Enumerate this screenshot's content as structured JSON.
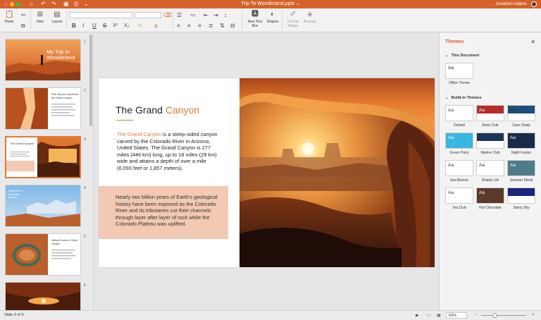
{
  "app": {
    "doc_title": "Trip To Wonderland.pptx",
    "user_name": "Jonathan Adams",
    "accent": "#d4622a"
  },
  "ribbon": {
    "paste": "Paste",
    "new": "New",
    "layout": "Layout",
    "new_text_box": "New Text Box",
    "shapes": "Shapes",
    "format_shape": "Format Shape",
    "arrange": "Arrange",
    "bold": "B",
    "italic": "I",
    "underline": "U",
    "strike": "S",
    "superscript": "X²",
    "subscript": "X₂"
  },
  "slides": {
    "numbers": [
      "1",
      "2",
      "3",
      "4",
      "5",
      "6"
    ],
    "t1_title": "My Trip to Wonderland",
    "t2_title": "Plan will you experience the Grand Canyon",
    "t3_title": "The Grand Canyon",
    "t4_title": "South Rim in the Grand Canyon",
    "t5_title": "Hiking Routes in Grand Canyon"
  },
  "slide": {
    "title_main": "The Grand ",
    "title_accent": "Canyon",
    "body_accent": "The Grand Canyon",
    "body_rest": " is a steep-sided canyon carved by the Colorado River in Arizona, United States. The Grand Canyon is 277 miles (446 km) long, up to 18 miles (29 km) wide and attains a depth of over a mile (6,093 feet or 1,857 meters).",
    "box_text": "Nearly two billion years of Earth's geological history have been exposed as the Colorado River and its tributaries cut their channels through layer after layer of rock while the Colorado Plateau was uplifted."
  },
  "themes": {
    "title": "Themes",
    "this_document": "This Document",
    "built_in": "Build-in Themes",
    "office_theme": "Office Theme",
    "aa": "Aa",
    "items": [
      {
        "name": "Default",
        "bg": "#ffffff",
        "fg": "#333333",
        "band": "",
        "colors": [
          "#4472c4",
          "#ed7d31",
          "#a5a5a5",
          "#ffc000",
          "#5b9bd5"
        ]
      },
      {
        "name": "Book Club",
        "bg": "#ffffff",
        "fg": "#ffffff",
        "band": "#b32d2d",
        "colors": [
          "#b32d2d",
          "#e58a2c",
          "#6b6b6b",
          "#c9a227",
          "#333333"
        ]
      },
      {
        "name": "Case Study",
        "bg": "#ffffff",
        "fg": "#333333",
        "band": "#1f4e79",
        "colors": [
          "#1f4e79",
          "#2e75b6",
          "#9dc3e6",
          "#70ad47",
          "#ffc000"
        ]
      },
      {
        "name": "Green Party",
        "bg": "#3ab7e0",
        "fg": "#ffffff",
        "band": "",
        "colors": [
          "#ffcc00",
          "#ff6600",
          "#66cc33",
          "#ffffff",
          "#003366"
        ]
      },
      {
        "name": "Marine Club",
        "bg": "#ffffff",
        "fg": "#333333",
        "band": "#1d3557",
        "colors": [
          "#1d3557",
          "#457b9d",
          "#e63946",
          "#a8dadc",
          "#f1c40f"
        ]
      },
      {
        "name": "Night Fusion",
        "bg": "#1b2a4a",
        "fg": "#ffffff",
        "band": "",
        "colors": [
          "#ffd400",
          "#ff7a00",
          "#ffffff",
          "#6fa8dc",
          "#333333"
        ]
      },
      {
        "name": "Sea Breeze",
        "bg": "#ffffff",
        "fg": "#333333",
        "band": "",
        "colors": [
          "#2a9df4",
          "#187bcd",
          "#a1d6e2",
          "#1995ad",
          "#ffbf00"
        ]
      },
      {
        "name": "Simple Life",
        "bg": "#ffffff",
        "fg": "#333333",
        "band": "",
        "colors": [
          "#7f8c8d",
          "#16a085",
          "#c0392b",
          "#2c3e50",
          "#f39c12"
        ]
      },
      {
        "name": "Summer Mood",
        "bg": "#4f7c8a",
        "fg": "#ffffff",
        "band": "",
        "colors": [
          "#f2d0a4",
          "#f78c6b",
          "#ffffff",
          "#83c5be",
          "#ffb703"
        ]
      },
      {
        "name": "Tea Club",
        "bg": "#ffffff",
        "fg": "#333333",
        "band": "",
        "colors": [
          "#2f6db5",
          "#e8b33c",
          "#9e2a2b",
          "#6c9a8b",
          "#333333"
        ]
      },
      {
        "name": "Hot Chocolate",
        "bg": "#5a3a2a",
        "fg": "#ffffff",
        "band": "",
        "colors": [
          "#f3d9b1",
          "#c97c5d",
          "#ffffff",
          "#8c5e4a",
          "#e0a96d"
        ]
      },
      {
        "name": "Starry Sky",
        "bg": "#ffffff",
        "fg": "#333333",
        "band": "#1a237e",
        "colors": [
          "#1a237e",
          "#3949ab",
          "#fbc02d",
          "#4fc3f7",
          "#e53935"
        ]
      }
    ]
  },
  "status": {
    "slide_count": "Slide 3 of 6",
    "zoom": "63%",
    "zoom_level": 0.3
  }
}
